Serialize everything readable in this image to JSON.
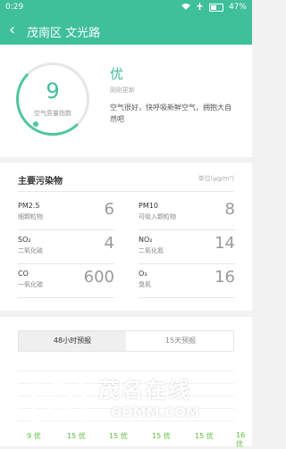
{
  "status_bar": {
    "time": "0:29",
    "battery": "47%"
  },
  "header": {
    "title": "茂南区 文光路"
  },
  "aqi": {
    "value": "9",
    "caption": "空气质量指数",
    "level": "优",
    "updated": "刚刚更新",
    "advice": "空气很好，快呼吸新鲜空气，拥抱大自然吧",
    "color": "#3fbf9a"
  },
  "pollutants": {
    "title": "主要污染物",
    "unit": "单位(μg/m³)",
    "items": [
      {
        "name": "PM2.5",
        "cn": "细颗粒物",
        "value": "6"
      },
      {
        "name": "PM10",
        "cn": "可吸入颗粒物",
        "value": "8"
      },
      {
        "name": "SO₂",
        "cn": "二氧化硫",
        "value": "4"
      },
      {
        "name": "NO₂",
        "cn": "二氧化氮",
        "value": "14"
      },
      {
        "name": "CO",
        "cn": "一氧化碳",
        "value": "600"
      },
      {
        "name": "O₃",
        "cn": "臭氧",
        "value": "16"
      }
    ]
  },
  "forecast": {
    "tabs": [
      "48小时预报",
      "15天预报"
    ],
    "labels": [
      "9 优",
      "15 优",
      "15 优",
      "15 优",
      "15 优",
      "16 优"
    ],
    "good_color": "#5cbf3a"
  },
  "watermark": {
    "cn": "茂名在线",
    "en": "GDMM.COM"
  }
}
